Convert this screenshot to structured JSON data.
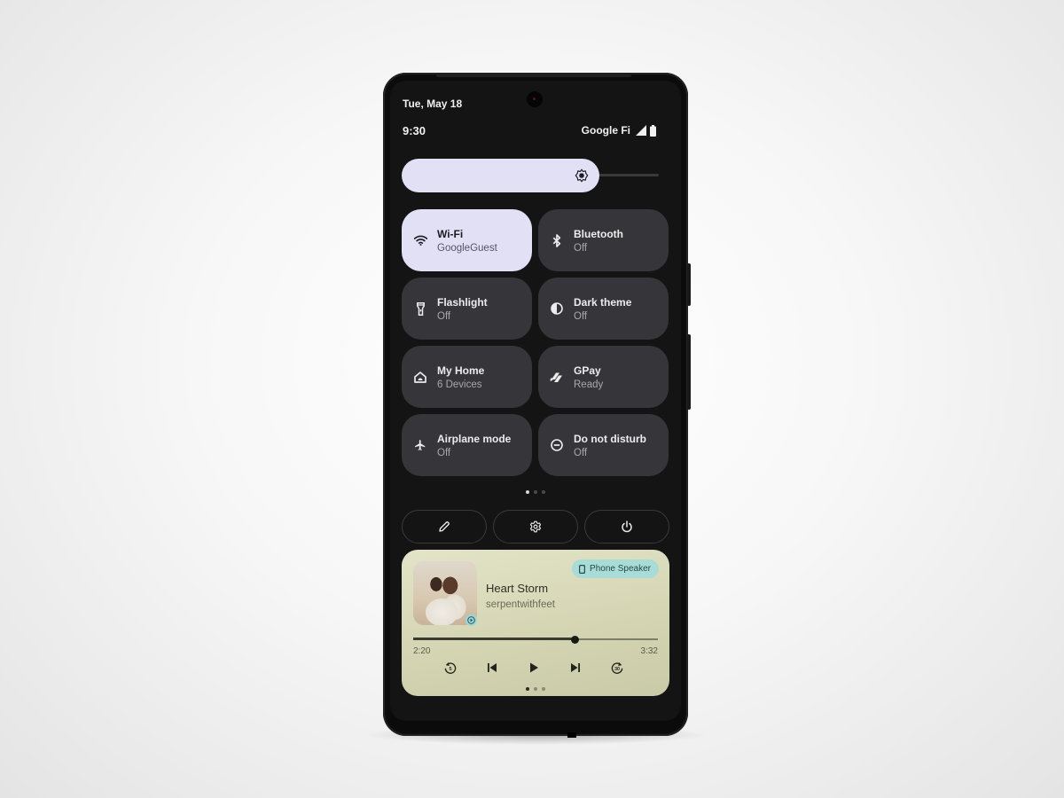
{
  "status_bar": {
    "date": "Tue, May 18",
    "time": "9:30",
    "carrier": "Google Fi",
    "signal_icon": "cell-signal-icon",
    "battery_icon": "battery-full-icon"
  },
  "brightness": {
    "icon": "brightness-icon",
    "level": 0.77
  },
  "tiles": [
    {
      "label": "Wi-Fi",
      "sub": "GoogleGuest",
      "icon": "wifi-icon",
      "active": true
    },
    {
      "label": "Bluetooth",
      "sub": "Off",
      "icon": "bluetooth-icon",
      "active": false
    },
    {
      "label": "Flashlight",
      "sub": "Off",
      "icon": "flashlight-icon",
      "active": false
    },
    {
      "label": "Dark theme",
      "sub": "Off",
      "icon": "dark-theme-icon",
      "active": false
    },
    {
      "label": "My Home",
      "sub": "6 Devices",
      "icon": "home-icon",
      "active": false
    },
    {
      "label": "GPay",
      "sub": "Ready",
      "icon": "gpay-icon",
      "active": false
    },
    {
      "label": "Airplane mode",
      "sub": "Off",
      "icon": "airplane-icon",
      "active": false
    },
    {
      "label": "Do not disturb",
      "sub": "Off",
      "icon": "do-not-disturb-icon",
      "active": false
    }
  ],
  "tile_pages": {
    "count": 3,
    "current": 0
  },
  "actions": [
    {
      "name": "edit",
      "icon": "pencil-icon"
    },
    {
      "name": "settings",
      "icon": "gear-icon"
    },
    {
      "name": "power",
      "icon": "power-icon"
    }
  ],
  "media": {
    "title": "Heart Storm",
    "artist": "serpentwithfeet",
    "output_label": "Phone Speaker",
    "output_icon": "phone-icon",
    "elapsed": "2:20",
    "duration": "3:32",
    "progress": 0.66,
    "controls": [
      "replay-5-icon",
      "skip-previous-icon",
      "play-icon",
      "skip-next-icon",
      "forward-30-icon"
    ],
    "pages": {
      "count": 3,
      "current": 0
    },
    "colors": {
      "card": "#d9dabb",
      "chip": "#a9dcd6"
    }
  },
  "colors": {
    "screen_bg": "#141414",
    "tile_bg": "#36363a",
    "tile_active_bg": "#e1e0f5"
  }
}
